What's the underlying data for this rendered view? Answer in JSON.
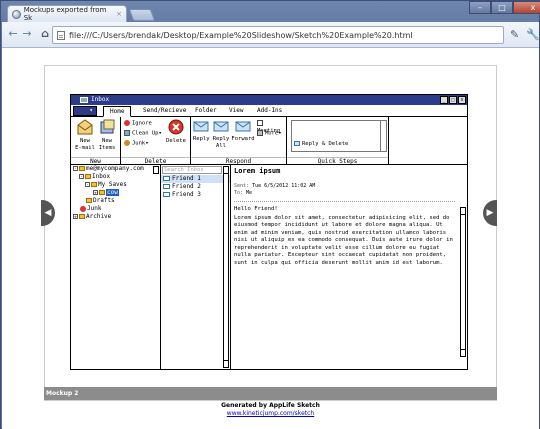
{
  "browser": {
    "tab_title": "Mockups exported from Sk",
    "tab_close": "×",
    "new_tab": "",
    "back": "←",
    "forward": "→",
    "reload": "C",
    "home": "⌂",
    "url": "file:///C:/Users/brendak/Desktop/Example%20Slideshow/Sketch%20Example%20.html",
    "min": "–",
    "max": "□",
    "close": "x"
  },
  "mockup": {
    "window_title": "Inbox",
    "ribbon_tabs": [
      "Home",
      "Send/Recieve",
      "Folder",
      "View",
      "Add-Ins"
    ],
    "groups": {
      "new": {
        "label": "New",
        "new_email": "New\nE-mail",
        "new_items": "New\nItems"
      },
      "delete": {
        "label": "Delete",
        "ignore": "Ignore",
        "clean_up": "Clean Up▾",
        "junk": "Junk▾",
        "delete": "Delete"
      },
      "respond": {
        "label": "Respond",
        "reply": "Reply",
        "reply_all": "Reply\nAll",
        "forward": "Forward",
        "meeting": "Meeting",
        "more": "More▾"
      },
      "quick_steps": {
        "label": "Quick Steps",
        "item": "Reply & Delete"
      }
    },
    "folders": {
      "account": "me@mycompany.com",
      "inbox": "Inbox",
      "my_saves": "My Saves",
      "selected": "cow",
      "drafts": "Drafts",
      "junk": "Junk",
      "archive": "Archive"
    },
    "list": {
      "search_placeholder": "Search Inbox",
      "items": [
        "Friend 1",
        "Friend 2",
        "Friend 3"
      ]
    },
    "reading": {
      "subject": "Lorem ipsum",
      "sent_label": "Sent:",
      "sent_value": "Tue 6/5/2012 11:02 AM",
      "to_label": "To:",
      "to_value": "Me",
      "greeting": "Hello Friend!",
      "body": "Lorem ipsum dolor sit amet, consectetur adipisicing elit, sed do eiusmod tempor incididunt ut labore et dolore magna aliqua. Ut enim ad minim veniam, quis nostrud exercitation ullamco laboris nisi ut aliquip ex ea commodo consequat. Duis aute irure dolor in reprehenderit in voluptate velit esse cillum dolore eu fugiat nulla pariatur. Excepteur sint occaecat cupidatat non proident, sunt in culpa qui officia deserunt mollit anim id est laborum."
    }
  },
  "footer": {
    "mockup_label": "Mockup 2",
    "generated": "Generated by AppLife Sketch",
    "link": "www.kineticjump.com/sketch"
  },
  "colors": {
    "title_bar": "#2c3c8a",
    "browser_frame": "#5b729c",
    "selection": "#1f5fbf"
  }
}
